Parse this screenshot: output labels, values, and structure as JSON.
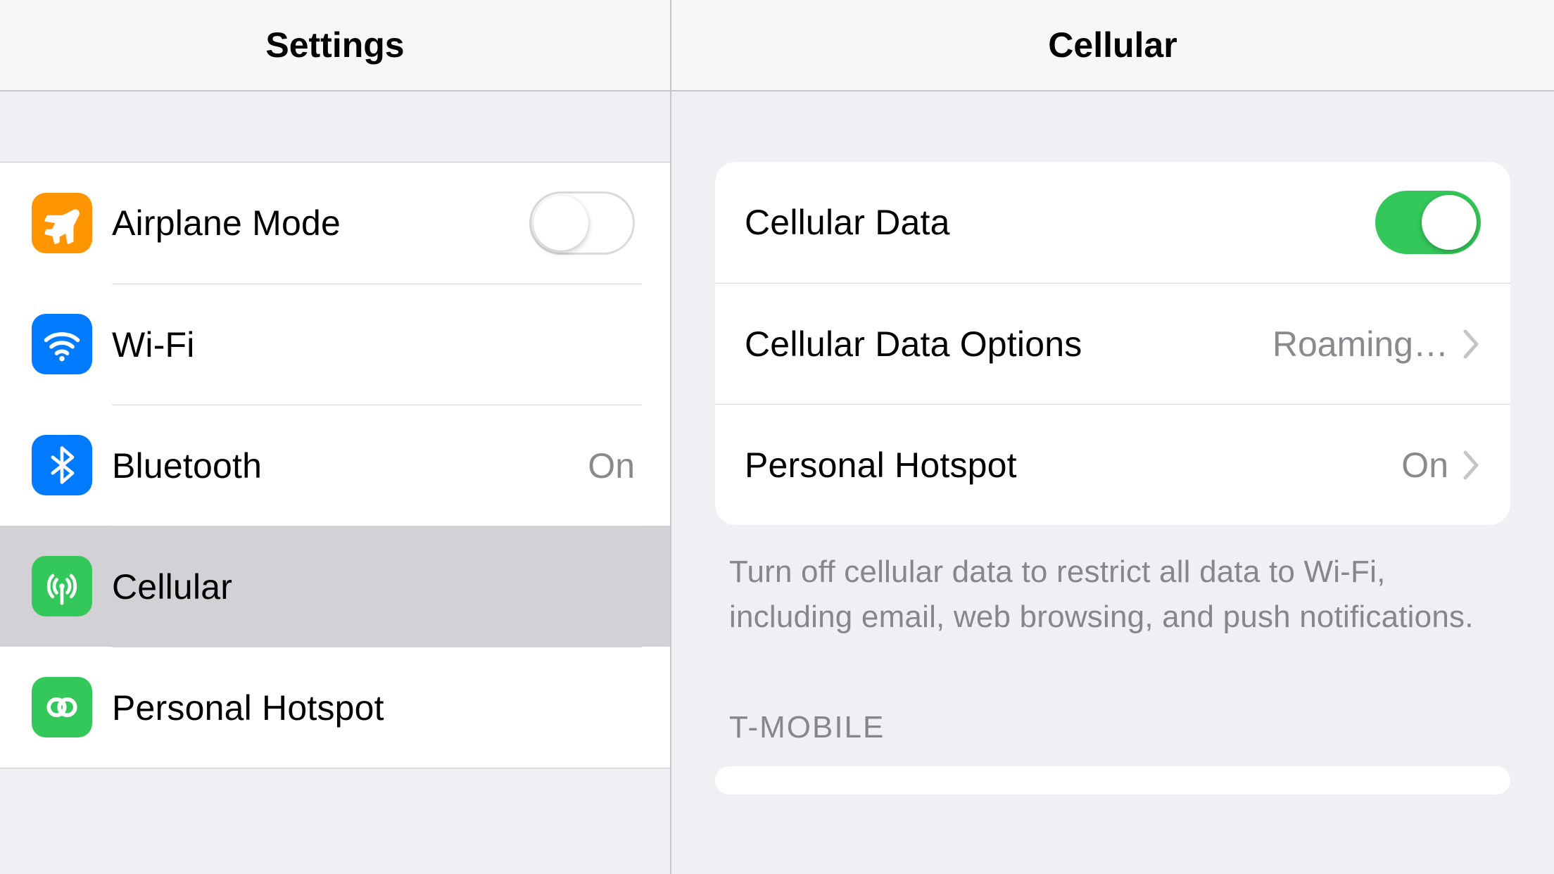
{
  "sidebar": {
    "title": "Settings",
    "items": [
      {
        "label": "Airplane Mode",
        "toggle": false
      },
      {
        "label": "Wi-Fi",
        "value": null
      },
      {
        "label": "Bluetooth",
        "value": "On"
      },
      {
        "label": "Cellular",
        "selected": true
      },
      {
        "label": "Personal Hotspot",
        "value": null
      }
    ]
  },
  "detail": {
    "title": "Cellular",
    "rows": [
      {
        "label": "Cellular Data",
        "toggle": true
      },
      {
        "label": "Cellular Data Options",
        "value": "Roaming…",
        "chevron": true
      },
      {
        "label": "Personal Hotspot",
        "value": "On",
        "chevron": true
      }
    ],
    "footer": "Turn off cellular data to restrict all data to Wi-Fi, including email, web browsing, and push notifications.",
    "carrier_heading": "T-MOBILE"
  }
}
